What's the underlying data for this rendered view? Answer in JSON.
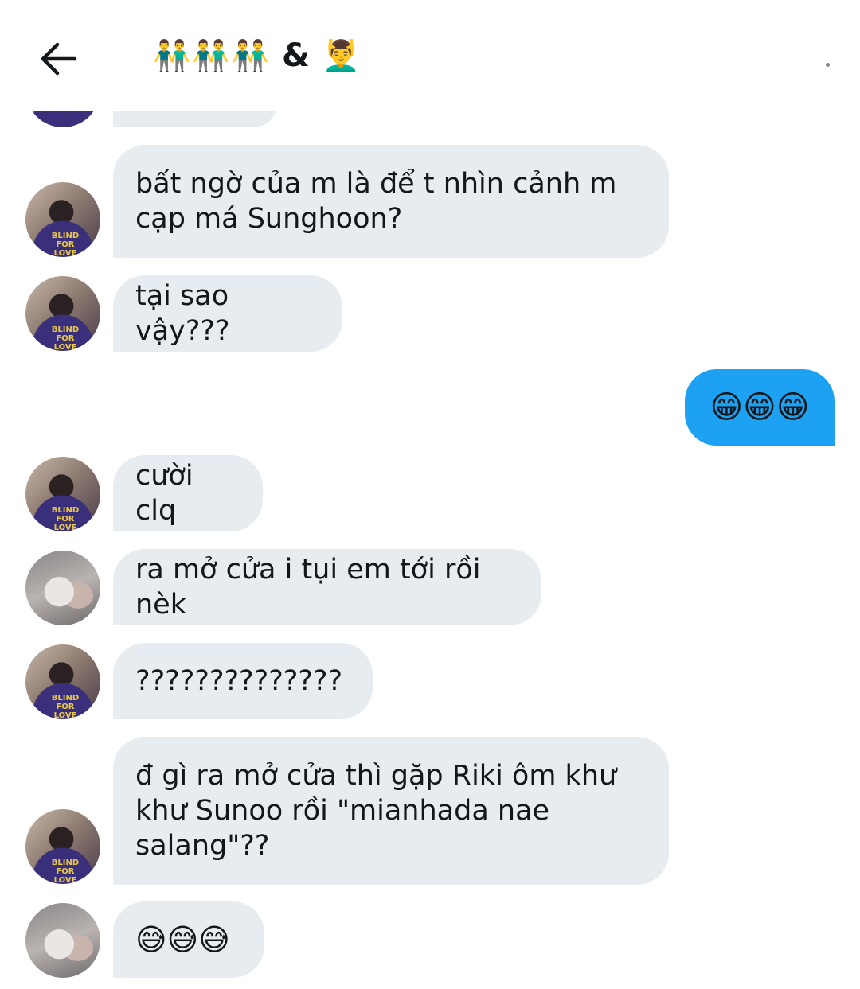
{
  "header": {
    "title_emoji_left": "👬👬👬",
    "title_amp": "&",
    "title_emoji_right": "💆‍♂️"
  },
  "messages": [
    {
      "text": "bất ngờ của m là để t nhìn cảnh m\ncạp má Sunghoon?",
      "side": "in",
      "avatar": "avatar-purple-shirt"
    },
    {
      "text": "tại sao vậy???",
      "side": "in",
      "avatar": "avatar-purple-shirt"
    },
    {
      "text": "😁😁😁",
      "side": "out"
    },
    {
      "text": "cười clq",
      "side": "in",
      "avatar": "avatar-purple-shirt"
    },
    {
      "text": "ra mở cửa i tụi em tới rồi nèk",
      "side": "in",
      "avatar": "avatar-blurry-hand"
    },
    {
      "text": "??????????????",
      "side": "in",
      "avatar": "avatar-purple-shirt"
    },
    {
      "text": "đ gì ra mở cửa thì gặp Riki ôm khư\nkhư Sunoo rồi \"mianhada nae\nsalang\"??",
      "side": "in",
      "avatar": "avatar-purple-shirt"
    },
    {
      "text": "😅😅😅",
      "side": "in",
      "avatar": "avatar-blurry-hand"
    }
  ],
  "colors": {
    "incoming_bubble": "#e6ecf0",
    "outgoing_bubble": "#1da1f2"
  }
}
